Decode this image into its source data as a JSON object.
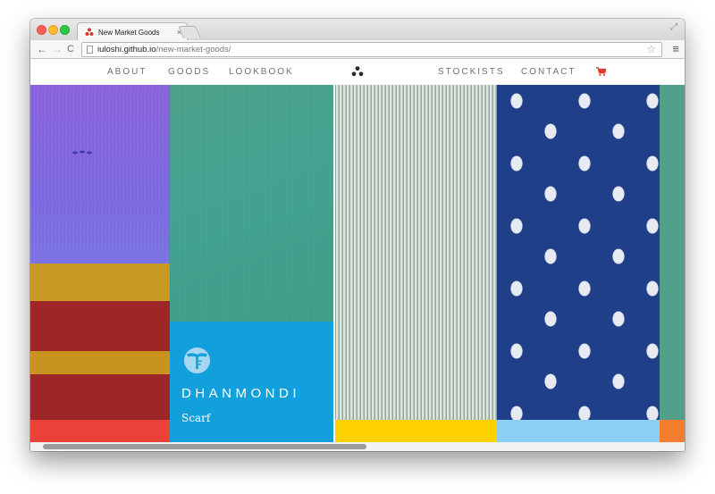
{
  "browser": {
    "tab": {
      "title": "New Market Goods",
      "close_glyph": "×"
    },
    "controls": {
      "back_glyph": "←",
      "forward_glyph": "→",
      "reload_glyph": "C",
      "star_glyph": "☆",
      "menu_glyph": "≡",
      "fullscreen_glyph": "⤢"
    },
    "url": {
      "host": "iuloshi.github.io",
      "path": "/new-market-goods/"
    }
  },
  "site": {
    "nav": {
      "left": [
        "ABOUT",
        "GOODS",
        "LOOKBOOK"
      ],
      "right": [
        "STOCKISTS",
        "CONTACT"
      ],
      "logo_icon": "three-dots-logo-icon",
      "cart_icon": "shopping-cart-icon",
      "cart_color": "#e8392e"
    },
    "feature": {
      "title": "DHANMONDI",
      "subtitle": "Scarf",
      "icon": "leaf-badge-icon",
      "background": "#12a0dd"
    },
    "fabrics": [
      {
        "name": "purple-and-stripe",
        "color": "#7f6ae0"
      },
      {
        "name": "green-weave",
        "color": "#44a593"
      },
      {
        "name": "grey-weave",
        "color": "#c6d2c8"
      },
      {
        "name": "indigo-leaf-print",
        "color": "#1f3f88"
      },
      {
        "name": "green-edge",
        "color": "#52a18c"
      }
    ],
    "swatches": [
      "#ea4238",
      "#12a0dd",
      "#fdd000",
      "#8ccff4",
      "#f57d2f"
    ]
  }
}
